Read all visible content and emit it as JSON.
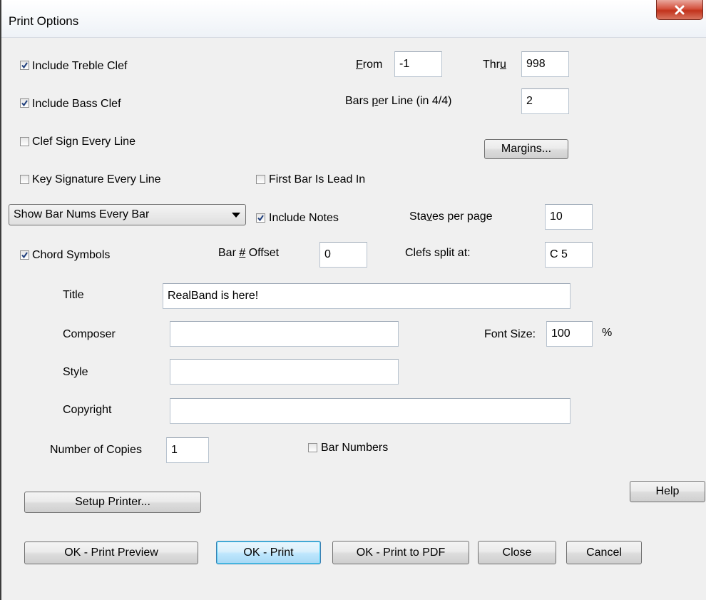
{
  "window": {
    "title": "Print Options",
    "close_icon": "close-icon"
  },
  "checkboxes": {
    "treble": {
      "label": "Include Treble Clef",
      "checked": true
    },
    "bass": {
      "label": "Include Bass Clef",
      "checked": true
    },
    "clef_every_line": {
      "label": "Clef Sign Every Line",
      "checked": false
    },
    "key_every_line": {
      "label": "Key Signature Every Line",
      "checked": false
    },
    "first_bar_lead": {
      "label": "First Bar Is Lead In",
      "checked": false
    },
    "include_notes": {
      "label": "Include Notes",
      "checked": true
    },
    "chord_symbols": {
      "label": "Chord Symbols",
      "checked": true
    },
    "bar_numbers": {
      "label": "Bar Numbers",
      "checked": false
    }
  },
  "range": {
    "from_prefix": "",
    "from_underline": "F",
    "from_suffix": "rom",
    "from_value": "-1",
    "thru_prefix": "Thr",
    "thru_underline": "u",
    "thru_suffix": "",
    "thru_value": "998"
  },
  "bars_per_line": {
    "prefix": "Bars ",
    "underline": "p",
    "suffix": "er Line (in 4/4)",
    "value": "2"
  },
  "margins_button": "Margins...",
  "bar_num_dropdown": {
    "selected": "Show Bar Nums Every Bar"
  },
  "staves": {
    "prefix": "Sta",
    "underline": "v",
    "suffix": "es per page",
    "value": "10"
  },
  "bar_offset": {
    "prefix": "Bar ",
    "underline": "#",
    "suffix": " Offset",
    "value": "0"
  },
  "clefs_split": {
    "label": "Clefs split at:",
    "value": "C 5"
  },
  "text_fields": {
    "title_label": "Title",
    "title_value": "RealBand is here!",
    "composer_label": "Composer",
    "composer_value": "",
    "style_label": "Style",
    "style_value": "",
    "copyright_label": "Copyright",
    "copyright_value": ""
  },
  "font_size": {
    "label": "Font Size:",
    "value": "100",
    "unit": "%"
  },
  "copies": {
    "label": "Number of Copies",
    "value": "1"
  },
  "buttons": {
    "setup_printer": "Setup Printer...",
    "help": "Help",
    "ok_preview": "OK - Print Preview",
    "ok_print": "OK - Print",
    "ok_pdf": "OK - Print to PDF",
    "close": "Close",
    "cancel": "Cancel"
  }
}
